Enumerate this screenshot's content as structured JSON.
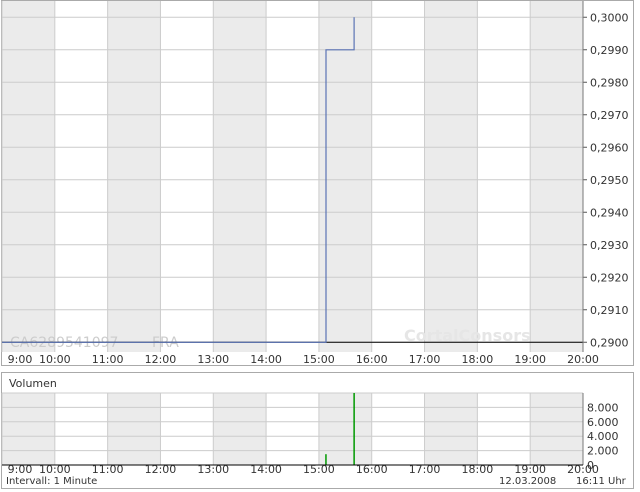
{
  "chart_data": [
    {
      "type": "line",
      "title": "",
      "instrument_id": "CA6289541097",
      "exchange": "FRA",
      "watermark": "CortalConsors",
      "x_tick_labels": [
        "9:00",
        "10:00",
        "11:00",
        "12:00",
        "13:00",
        "14:00",
        "15:00",
        "16:00",
        "17:00",
        "18:00",
        "19:00",
        "20:00"
      ],
      "y_tick_labels": [
        "0,3000",
        "0,2990",
        "0,2980",
        "0,2970",
        "0,2960",
        "0,2950",
        "0,2940",
        "0,2930",
        "0,2920",
        "0,2910",
        "0,2900"
      ],
      "xlim": [
        "09:00",
        "20:00"
      ],
      "ylim": [
        0.2897,
        0.3005
      ],
      "grid": true,
      "reference_value": 0.29,
      "series": [
        {
          "color": "#5a73b4",
          "points": [
            {
              "x": "09:00",
              "y": 0.29
            },
            {
              "x": "15:08",
              "y": 0.29
            },
            {
              "x": "15:08",
              "y": 0.299
            },
            {
              "x": "15:40",
              "y": 0.299
            },
            {
              "x": "15:40",
              "y": 0.3
            }
          ]
        }
      ]
    },
    {
      "type": "bar",
      "title": "Volumen",
      "x_tick_labels": [
        "9:00",
        "10:00",
        "11:00",
        "12:00",
        "13:00",
        "14:00",
        "15:00",
        "16:00",
        "17:00",
        "18:00",
        "19:00",
        "20:00"
      ],
      "y_tick_labels": [
        "8.000",
        "6.000",
        "4.000",
        "2.000",
        "0"
      ],
      "ylim": [
        0,
        10000
      ],
      "grid": true,
      "bar_color": "#009900",
      "bars": [
        {
          "x": "15:08",
          "y": 1500
        },
        {
          "x": "15:40",
          "y": 10000
        }
      ]
    }
  ],
  "footer": {
    "interval": "Intervall: 1 Minute",
    "date": "12.03.2008",
    "time": "16:11 Uhr"
  },
  "colors": {
    "band_shade": "#ebebeb",
    "grid": "#cccccc",
    "price_line": "#5a73b4",
    "reference_line": "#000000",
    "volume_bar": "#009900"
  }
}
